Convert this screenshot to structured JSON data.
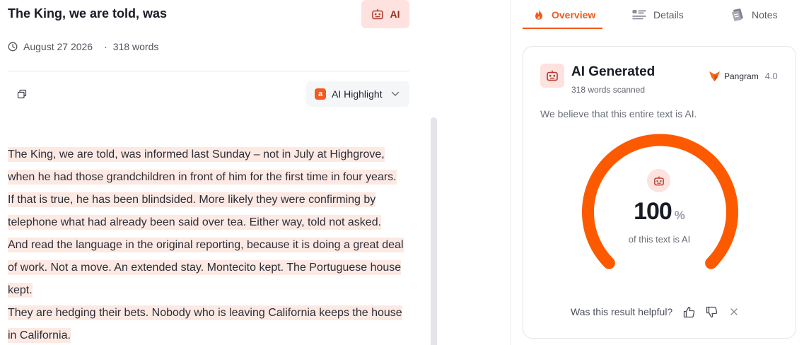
{
  "document": {
    "title": "The King, we are told, was",
    "tag_label": "AI",
    "date": "August 27 2026",
    "separator": "·",
    "word_count": "318 words",
    "highlight_button_label": "AI Highlight",
    "highlight_badge": "a",
    "paragraphs": [
      {
        "lines": [
          "The King, we are told, was informed last Sunday – not in July at Highgrove,",
          "when he had those grandchildren in front of him for the first time in four years.",
          "If that is true, he has been blindsided. More likely they were confirming by",
          "telephone what had already been said over tea. Either way, told not asked."
        ]
      },
      {
        "lines": [
          "And read the language in the original reporting, because it is doing a great deal",
          "of work. Not a move. An extended stay. Montecito kept. The Portuguese house",
          "kept."
        ]
      },
      {
        "lines": [
          "They are hedging their bets. Nobody who is leaving California keeps the house",
          "in California."
        ]
      }
    ]
  },
  "sidebar": {
    "tabs": [
      {
        "label": "Overview",
        "icon": "flame-icon",
        "active": true
      },
      {
        "label": "Details",
        "icon": "details-list-icon",
        "active": false
      },
      {
        "label": "Notes",
        "icon": "notes-icon",
        "active": false
      }
    ],
    "result": {
      "title": "AI Generated",
      "words_scanned": "318 words scanned",
      "brand_name": "Pangram",
      "brand_version": "4.0",
      "verdict": "We believe that this entire text is AI.",
      "score": 100,
      "score_value": "100",
      "score_unit": "%",
      "score_caption": "of this text is AI",
      "feedback_prompt": "Was this result helpful?"
    }
  },
  "colors": {
    "accent": "#ef5a1c",
    "ai_tag_bg": "#fde2df",
    "ai_tag_text": "#9a2a1f",
    "highlight_bg": "#fde9e4",
    "gauge_stroke": "#fd5a00"
  }
}
